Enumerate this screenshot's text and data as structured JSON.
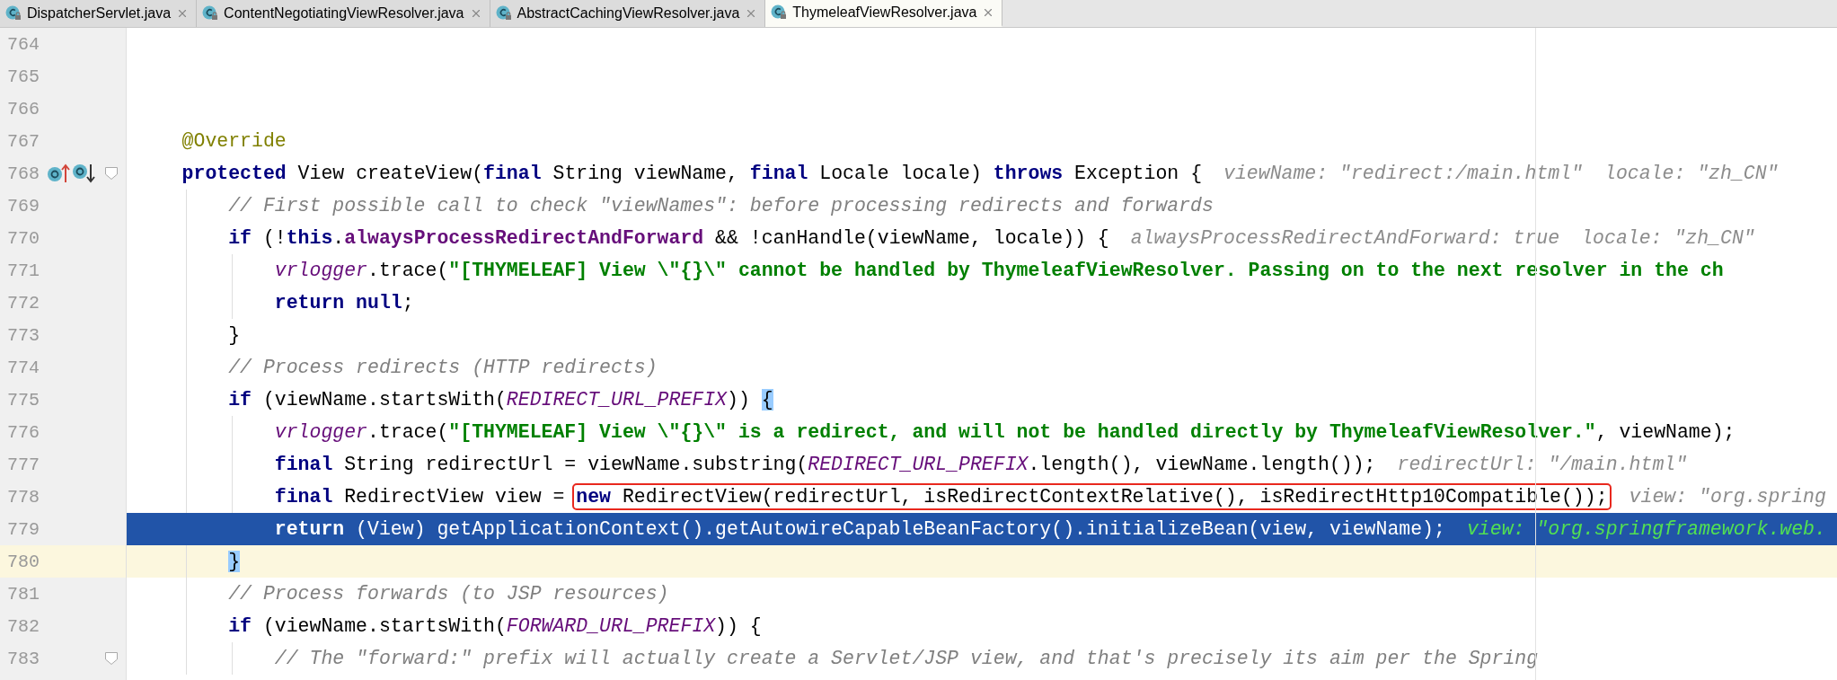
{
  "tabs": [
    {
      "label": "DispatcherServlet.java",
      "selected": false
    },
    {
      "label": "ContentNegotiatingViewResolver.java",
      "selected": false
    },
    {
      "label": "AbstractCachingViewResolver.java",
      "selected": false
    },
    {
      "label": "ThymeleafViewResolver.java",
      "selected": true
    }
  ],
  "lines": [
    {
      "number": "764",
      "execution_point": false,
      "current": false,
      "fold": false
    },
    {
      "number": "765",
      "execution_point": false,
      "current": false,
      "fold": false
    },
    {
      "number": "766",
      "execution_point": false,
      "current": false,
      "fold": false
    },
    {
      "number": "767",
      "execution_point": false,
      "current": false,
      "fold": false,
      "tokens": [
        {
          "kind": "annotation",
          "text": "@Override"
        }
      ]
    },
    {
      "number": "768",
      "execution_point": false,
      "current": false,
      "fold": true,
      "gutter_icons": [
        {
          "kind": "overrides"
        },
        {
          "kind": "overridden"
        }
      ],
      "tokens": [
        {
          "kind": "keyword",
          "text": "protected"
        },
        {
          "kind": "text",
          "text": " View createView("
        },
        {
          "kind": "keyword",
          "text": "final"
        },
        {
          "kind": "text",
          "text": " String viewName, "
        },
        {
          "kind": "keyword",
          "text": "final"
        },
        {
          "kind": "text",
          "text": " Locale locale) "
        },
        {
          "kind": "keyword",
          "text": "throws"
        },
        {
          "kind": "text",
          "text": " Exception {"
        },
        {
          "kind": "hint",
          "text": "viewName: \"redirect:/main.html\""
        },
        {
          "kind": "hint",
          "text": "locale: \"zh_CN\""
        }
      ],
      "children": [
        {
          "number": "769",
          "execution_point": false,
          "current": false,
          "fold": false,
          "tokens": [
            {
              "kind": "comment",
              "text": "// First possible call to check \"viewNames\": before processing redirects and forwards"
            }
          ]
        },
        {
          "number": "770",
          "execution_point": false,
          "current": false,
          "fold": false,
          "tokens": [
            {
              "kind": "keyword",
              "text": "if"
            },
            {
              "kind": "text",
              "text": " (!"
            },
            {
              "kind": "keyword",
              "text": "this"
            },
            {
              "kind": "text",
              "text": "."
            },
            {
              "kind": "field",
              "text": "alwaysProcessRedirectAndForward"
            },
            {
              "kind": "text",
              "text": " && !canHandle(viewName, locale)) {"
            },
            {
              "kind": "hint",
              "text": "alwaysProcessRedirectAndForward: true"
            },
            {
              "kind": "hint",
              "text": "locale: \"zh_CN\""
            }
          ],
          "children": [
            {
              "number": "771",
              "execution_point": false,
              "current": false,
              "fold": false,
              "tokens": [
                {
                  "kind": "constant",
                  "text": "vrlogger"
                },
                {
                  "kind": "text",
                  "text": ".trace("
                },
                {
                  "kind": "string",
                  "text": "\"[THYMELEAF] View \\\"{}\\\" cannot be handled by ThymeleafViewResolver. Passing on to the next resolver in the ch"
                }
              ]
            },
            {
              "number": "772",
              "execution_point": false,
              "current": false,
              "fold": false,
              "tokens": [
                {
                  "kind": "keyword",
                  "text": "return null"
                },
                {
                  "kind": "text",
                  "text": ";"
                }
              ]
            }
          ]
        },
        {
          "number": "773",
          "execution_point": false,
          "current": false,
          "fold": false,
          "tokens": [
            {
              "kind": "text",
              "text": "}"
            }
          ]
        },
        {
          "number": "774",
          "execution_point": false,
          "current": false,
          "fold": false,
          "tokens": [
            {
              "kind": "comment",
              "text": "// Process redirects (HTTP redirects)"
            }
          ]
        },
        {
          "number": "775",
          "execution_point": false,
          "current": false,
          "fold": false,
          "tokens": [
            {
              "kind": "keyword",
              "text": "if"
            },
            {
              "kind": "text",
              "text": " (viewName.startsWith("
            },
            {
              "kind": "constant",
              "text": "REDIRECT_URL_PREFIX"
            },
            {
              "kind": "text",
              "text": ")) "
            },
            {
              "kind": "match",
              "text": "{"
            }
          ],
          "children": [
            {
              "number": "776",
              "execution_point": false,
              "current": false,
              "fold": false,
              "tokens": [
                {
                  "kind": "constant",
                  "text": "vrlogger"
                },
                {
                  "kind": "text",
                  "text": ".trace("
                },
                {
                  "kind": "string",
                  "text": "\"[THYMELEAF] View \\\"{}\\\" is a redirect, and will not be handled directly by ThymeleafViewResolver.\""
                },
                {
                  "kind": "text",
                  "text": ", viewName);"
                }
              ]
            },
            {
              "number": "777",
              "execution_point": false,
              "current": false,
              "fold": false,
              "tokens": [
                {
                  "kind": "keyword",
                  "text": "final"
                },
                {
                  "kind": "text",
                  "text": " String redirectUrl = viewName.substring("
                },
                {
                  "kind": "constant",
                  "text": "REDIRECT_URL_PREFIX"
                },
                {
                  "kind": "text",
                  "text": ".length(), viewName.length());"
                },
                {
                  "kind": "hint",
                  "text": "redirectUrl: \"/main.html\""
                }
              ]
            },
            {
              "number": "778",
              "execution_point": false,
              "current": false,
              "fold": false,
              "tokens": [
                {
                  "kind": "keyword",
                  "text": "final"
                },
                {
                  "kind": "text",
                  "text": " RedirectView view = "
                },
                {
                  "kind": "box",
                  "children": [
                    {
                      "kind": "keyword",
                      "text": "new"
                    },
                    {
                      "kind": "text",
                      "text": " RedirectView(redirectUrl, isRedirectContextRelative(), isRedirectHttp10Compatible());"
                    }
                  ]
                },
                {
                  "kind": "hint",
                  "text": "view: \"org.spring"
                }
              ]
            },
            {
              "number": "779",
              "execution_point": true,
              "current": false,
              "fold": false,
              "tokens": [
                {
                  "kind": "keyword",
                  "text": "return"
                },
                {
                  "kind": "text",
                  "text": " (View) getApplicationContext().getAutowireCapableBeanFactory().initializeBean(view, viewName);"
                },
                {
                  "kind": "hint",
                  "text": "view: \"org.springframework.web."
                }
              ]
            }
          ]
        },
        {
          "number": "780",
          "execution_point": false,
          "current": true,
          "fold": false,
          "tokens": [
            {
              "kind": "match",
              "text": "}"
            }
          ]
        },
        {
          "number": "781",
          "execution_point": false,
          "current": false,
          "fold": false,
          "tokens": [
            {
              "kind": "comment",
              "text": "// Process forwards (to JSP resources)"
            }
          ]
        },
        {
          "number": "782",
          "execution_point": false,
          "current": false,
          "fold": false,
          "tokens": [
            {
              "kind": "keyword",
              "text": "if"
            },
            {
              "kind": "text",
              "text": " (viewName.startsWith("
            },
            {
              "kind": "constant",
              "text": "FORWARD_URL_PREFIX"
            },
            {
              "kind": "text",
              "text": ")) {"
            }
          ],
          "children": [
            {
              "number": "783",
              "execution_point": false,
              "current": false,
              "fold": true,
              "tokens": [
                {
                  "kind": "comment",
                  "text": "// The \"forward:\" prefix will actually create a Servlet/JSP view, and that's precisely its aim per the Spring"
                }
              ]
            }
          ]
        }
      ]
    }
  ]
}
